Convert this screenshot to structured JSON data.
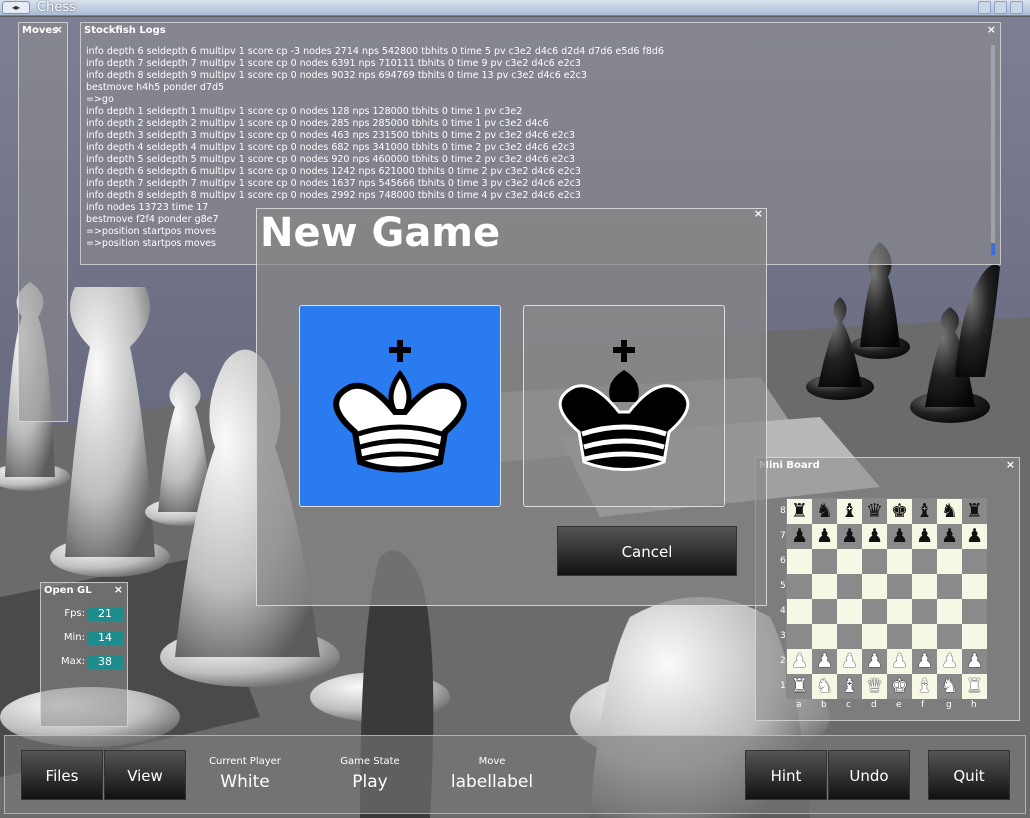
{
  "window": {
    "title": "Chess",
    "menu_glyph": "◂▸"
  },
  "moves": {
    "title": "Moves",
    "close": "×"
  },
  "logs": {
    "title": "Stockfish Logs",
    "close": "×",
    "lines": [
      "info depth 6 seldepth 6 multipv 1 score cp -3 nodes 2714 nps 542800 tbhits 0 time 5 pv c3e2 d4c6 d2d4 d7d6 e5d6 f8d6",
      "info depth 7 seldepth 7 multipv 1 score cp 0 nodes 6391 nps 710111 tbhits 0 time 9 pv c3e2 d4c6 e2c3",
      "info depth 8 seldepth 9 multipv 1 score cp 0 nodes 9032 nps 694769 tbhits 0 time 13 pv c3e2 d4c6 e2c3",
      "bestmove h4h5 ponder d7d5",
      "=>go",
      "info depth 1 seldepth 1 multipv 1 score cp 0 nodes 128 nps 128000 tbhits 0 time 1 pv c3e2",
      "info depth 2 seldepth 2 multipv 1 score cp 0 nodes 285 nps 285000 tbhits 0 time 1 pv c3e2 d4c6",
      "info depth 3 seldepth 3 multipv 1 score cp 0 nodes 463 nps 231500 tbhits 0 time 2 pv c3e2 d4c6 e2c3",
      "info depth 4 seldepth 4 multipv 1 score cp 0 nodes 682 nps 341000 tbhits 0 time 2 pv c3e2 d4c6 e2c3",
      "info depth 5 seldepth 5 multipv 1 score cp 0 nodes 920 nps 460000 tbhits 0 time 2 pv c3e2 d4c6 e2c3",
      "info depth 6 seldepth 6 multipv 1 score cp 0 nodes 1242 nps 621000 tbhits 0 time 2 pv c3e2 d4c6 e2c3",
      "info depth 7 seldepth 7 multipv 1 score cp 0 nodes 1637 nps 545666 tbhits 0 time 3 pv c3e2 d4c6 e2c3",
      "info depth 8 seldepth 8 multipv 1 score cp 0 nodes 2992 nps 748000 tbhits 0 time 4 pv c3e2 d4c6 e2c3",
      "info nodes 13723 time 17",
      "bestmove f2f4 ponder g8e7",
      "=>position startpos moves",
      "=>position startpos moves"
    ]
  },
  "dialog": {
    "title": "New Game",
    "close": "×",
    "white_choice": "white-king",
    "black_choice": "black-king",
    "cancel_label": "Cancel"
  },
  "opengl": {
    "title": "Open GL",
    "close": "×",
    "fps_label": "Fps:",
    "fps": "21",
    "min_label": "Min:",
    "min": "14",
    "max_label": "Max:",
    "max": "38"
  },
  "mini_board": {
    "title": "Mini Board",
    "close": "×",
    "ranks": [
      "8",
      "7",
      "6",
      "5",
      "4",
      "3",
      "2",
      "1"
    ],
    "files": [
      "a",
      "b",
      "c",
      "d",
      "e",
      "f",
      "g",
      "h"
    ],
    "rows": [
      [
        "♜",
        "♞",
        "♝",
        "♛",
        "♚",
        "♝",
        "♞",
        "♜"
      ],
      [
        "♟",
        "♟",
        "♟",
        "♟",
        "♟",
        "♟",
        "♟",
        "♟"
      ],
      [
        "",
        "",
        "",
        "",
        "",
        "",
        "",
        ""
      ],
      [
        "",
        "",
        "",
        "",
        "",
        "",
        "",
        ""
      ],
      [
        "",
        "",
        "",
        "",
        "",
        "",
        "",
        ""
      ],
      [
        "",
        "",
        "",
        "",
        "",
        "",
        "",
        ""
      ],
      [
        "♟",
        "♟",
        "♟",
        "♟",
        "♟",
        "♟",
        "♟",
        "♟"
      ],
      [
        "♜",
        "♞",
        "♝",
        "♛",
        "♚",
        "♝",
        "♞",
        "♜"
      ]
    ]
  },
  "bottom": {
    "files_label": "Files",
    "view_label": "View",
    "current_player_label": "Current Player",
    "current_player": "White",
    "game_state_label": "Game State",
    "game_state": "Play",
    "move_label": "Move",
    "move": "labellabel",
    "hint_label": "Hint",
    "undo_label": "Undo",
    "quit_label": "Quit"
  }
}
